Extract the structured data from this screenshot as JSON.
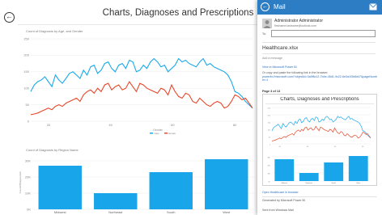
{
  "page": {
    "title": "Charts, Diagnoses and Prescriptions"
  },
  "colors": {
    "accent": "#2c7dc4",
    "series_blue": "#1aa9ea",
    "series_red": "#e8472b",
    "bars": "#18a5ea"
  },
  "icons": {
    "back": "arrow-left-icon",
    "send": "envelope-icon",
    "avatar": "avatar-icon"
  },
  "chart_data": [
    {
      "type": "line",
      "title": "Count of Diagnosis by Age, and Gender",
      "x_ticks": [
        "20",
        "40",
        "60",
        "80"
      ],
      "y_ticks": [
        "0",
        "50",
        "100",
        "150",
        "200",
        "250"
      ],
      "xlabel": "Gender",
      "legend": [
        "male",
        "female"
      ],
      "series": [
        {
          "name": "male",
          "values": [
            90,
            110,
            120,
            125,
            135,
            120,
            105,
            140,
            125,
            115,
            130,
            145,
            150,
            140,
            130,
            155,
            140,
            165,
            170,
            145,
            155,
            175,
            180,
            160,
            150,
            170,
            175,
            160,
            185,
            180,
            150,
            155,
            170,
            160,
            180,
            190,
            180,
            165,
            170,
            150,
            160,
            170,
            190,
            180,
            185,
            175,
            170,
            165,
            180,
            190,
            170,
            175,
            165,
            160,
            155,
            150,
            140,
            120,
            90,
            85,
            75,
            60,
            50,
            40
          ]
        },
        {
          "name": "female",
          "values": [
            20,
            22,
            25,
            30,
            35,
            40,
            35,
            45,
            50,
            45,
            55,
            60,
            65,
            70,
            60,
            80,
            90,
            95,
            85,
            100,
            90,
            110,
            115,
            95,
            105,
            110,
            95,
            100,
            120,
            105,
            90,
            115,
            110,
            100,
            95,
            90,
            85,
            100,
            95,
            80,
            110,
            90,
            75,
            70,
            85,
            80,
            60,
            55,
            70,
            60,
            50,
            45,
            55,
            60,
            55,
            40,
            45,
            60,
            80,
            75,
            65,
            70,
            55,
            40
          ]
        }
      ],
      "ylim": [
        0,
        250
      ]
    },
    {
      "type": "bar",
      "title": "Count of Diagnosis by Region Name",
      "categories": [
        "Midwest",
        "Northeast",
        "South",
        "West"
      ],
      "values": [
        27,
        10,
        23,
        31
      ],
      "y_ticks": [
        "0K",
        "10K",
        "20K",
        "30K"
      ],
      "ylabel": "CountOfDiagnosisId",
      "ylim": [
        0,
        33
      ]
    }
  ],
  "mail": {
    "header": "Mail",
    "from_name": "Administrator Administrator",
    "from_address": "firstname.lastname@outlook.com",
    "to_label": "To:",
    "to_value": "",
    "subject": "Healthcare.xlsx",
    "body_placeholder": "Add a message",
    "view_link": "View in Microsoft Power BI",
    "copy_hint": "Or copy and paste the following link in the browser:",
    "long_url": "powerbi://microsoft.com/?objectId=3a9f8c12-7b4e-45d1-9c22-6e0a1f3b8d47&pageNumber=1",
    "page_indicator": "Page 3 of 13",
    "embedded_title": "Charts, Diagnoses and Prescriptions",
    "open_link": "Open Healthcare in browser",
    "generated_by": "Generated by Microsoft Power BI",
    "sent_from": "Sent from Windows Mail"
  }
}
